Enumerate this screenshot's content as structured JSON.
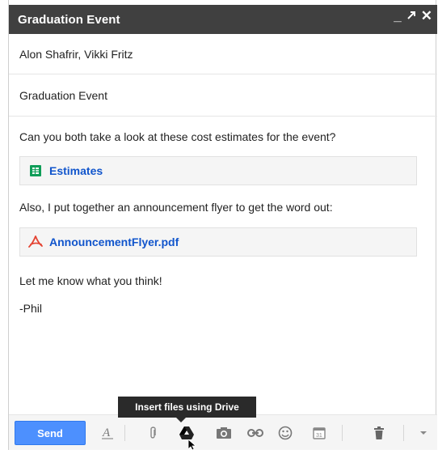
{
  "window": {
    "title": "Graduation Event"
  },
  "compose": {
    "recipients": "Alon Shafrir, Vikki Fritz",
    "subject": "Graduation Event",
    "body_line1": "Can you both take a look at these cost estimates for the event?",
    "attachment1": {
      "label": "Estimates",
      "icon": "sheets-icon"
    },
    "body_line2": "Also, I put together an announcement flyer to get the word out:",
    "attachment2": {
      "label": "AnnouncementFlyer.pdf",
      "icon": "pdf-icon"
    },
    "body_line3": "Let me know what you think!",
    "signature": "-Phil"
  },
  "toolbar": {
    "send_label": "Send",
    "tooltip": "Insert files using Drive"
  },
  "colors": {
    "titlebar": "#404040",
    "send": "#4d90fe",
    "link": "#1155cc",
    "sheets_green": "#0f9d58",
    "pdf_red": "#e44332"
  }
}
